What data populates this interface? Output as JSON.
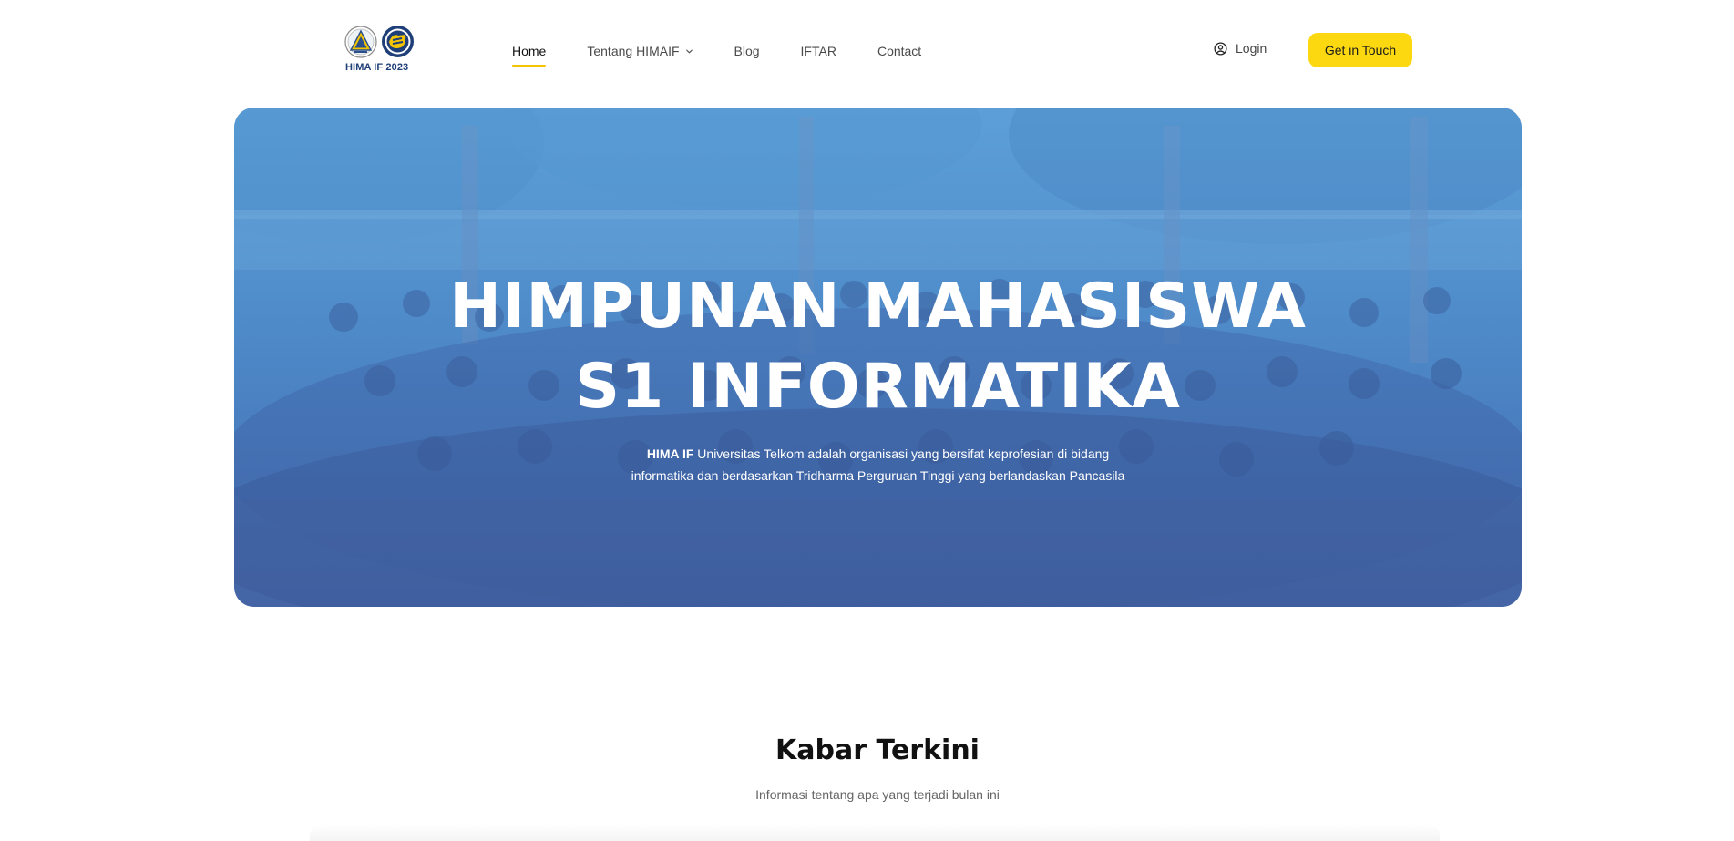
{
  "brand": {
    "logo_text": "HIMA IF 2023",
    "accent_color": "#fcd811",
    "hero_blue": "#5190cc"
  },
  "nav": {
    "items": [
      {
        "label": "Home",
        "active": true
      },
      {
        "label": "Tentang HIMAIF",
        "has_dropdown": true
      },
      {
        "label": "Blog"
      },
      {
        "label": "IFTAR"
      },
      {
        "label": "Contact"
      }
    ],
    "login_label": "Login",
    "login_icon": "user-circle-icon",
    "cta_label": "Get in Touch"
  },
  "hero": {
    "title_line1": "HIMPUNAN MAHASISWA",
    "title_line2": "S1 INFORMATIKA",
    "desc_bold": "HIMA IF",
    "desc_rest": " Universitas Telkom adalah organisasi yang bersifat keprofesian di bidang informatika dan berdasarkan Tridharma Perguruan Tinggi yang berlandaskan Pancasila"
  },
  "news": {
    "title": "Kabar Terkini",
    "subtitle": "Informasi tentang apa yang terjadi bulan ini"
  }
}
